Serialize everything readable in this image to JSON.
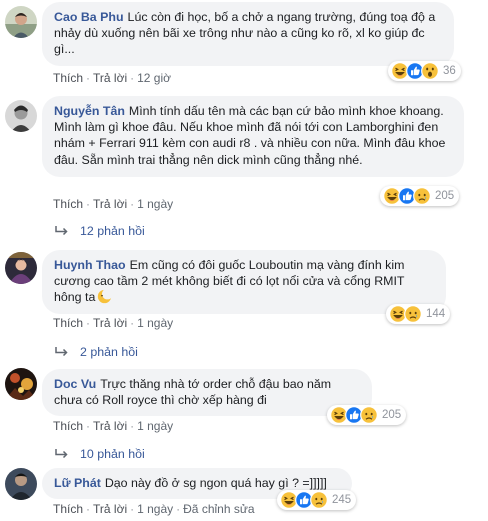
{
  "comments": [
    {
      "author": "Cao Ba Phu",
      "text": "Lúc còn đi học, bố a chở a ngang trường, đúng toạ độ a nhảy dù xuống nên bãi xe trông như nào a cũng ko rõ, xl ko giúp đc gì...",
      "like": "Thích",
      "reply": "Trả lời",
      "time": "12 giờ",
      "reaction_count": "36",
      "reactions": [
        "haha-icon",
        "like-icon",
        "wow-icon"
      ]
    },
    {
      "author": "Nguyễn Tân",
      "text": "Mình tính dấu tên mà các bạn cứ bảo mình khoe khoang. Mình làm gì khoe đâu. Nếu khoe mình đã nói tới con Lamborghini đen nhám + Ferrari 911 kèm con audi r8 . và nhiều con nữa. Mình đâu khoe đâu. Sẵn mình trai thẳng nên dick mình cũng thẳng nhé.",
      "like": "Thích",
      "reply": "Trả lời",
      "time": "1 ngày",
      "reaction_count": "205",
      "reactions": [
        "haha-icon",
        "like-icon",
        "sad-icon"
      ],
      "replies": "12 phản hồi"
    },
    {
      "author": "Huynh Thao",
      "text": "Em cũng có đôi guốc Louboutin mạ vàng đính kim cương cao tầm 2 mét không biết đi có lọt nổi cửa và cổng RMIT hông ta",
      "like": "Thích",
      "reply": "Trả lời",
      "time": "1 ngày",
      "reaction_count": "144",
      "reactions": [
        "haha-icon",
        "sad-icon"
      ],
      "replies": "2 phản hồi"
    },
    {
      "author": "Doc Vu",
      "text": "Trực thăng nhà tớ order chỗ đậu bao năm chưa có Roll royce thì chờ xếp hàng đi",
      "like": "Thích",
      "reply": "Trả lời",
      "time": "1 ngày",
      "reaction_count": "205",
      "reactions": [
        "haha-icon",
        "like-icon",
        "sad-icon"
      ],
      "replies": "10 phản hồi"
    },
    {
      "author": "Lữ Phát",
      "text": "Dạo này đồ ở sg ngon quá hay gì ? =]]]]]",
      "like": "Thích",
      "reply": "Trả lời",
      "time": "1 ngày",
      "edited": "Đã chỉnh sửa",
      "reaction_count": "245",
      "reactions": [
        "haha-icon",
        "like-icon",
        "sad-icon"
      ]
    }
  ],
  "colors": {
    "link": "#385898",
    "bubble": "#f2f3f5",
    "meta": "#606770",
    "like_blue": "#1877f2",
    "emoji_yellow": "#f7c13b"
  }
}
